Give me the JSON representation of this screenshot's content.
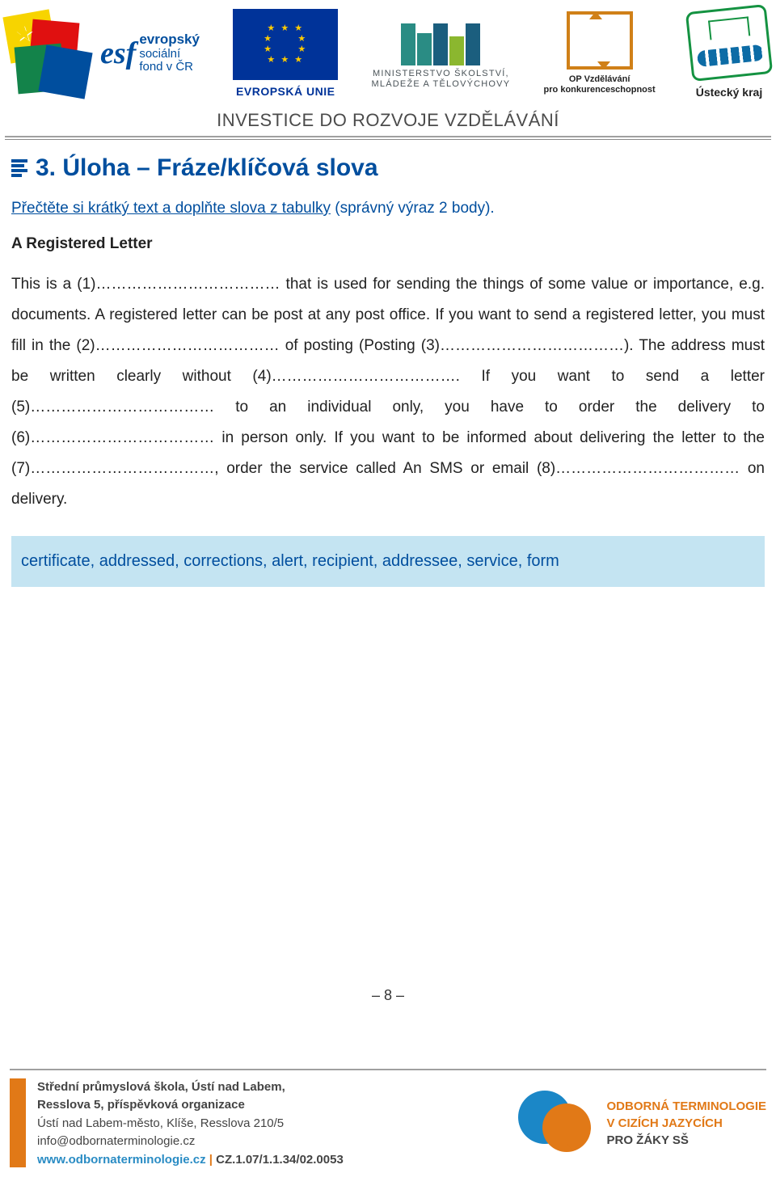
{
  "header": {
    "esf_line1": "evropský",
    "esf_line2": "sociální",
    "esf_line3": "fond v ČR",
    "eu_label": "EVROPSKÁ UNIE",
    "msmt_line1": "MINISTERSTVO ŠKOLSTVÍ,",
    "msmt_line2": "MLÁDEŽE A TĚLOVÝCHOVY",
    "op_line1": "OP Vzdělávání",
    "op_line2": "pro konkurenceschopnost",
    "kraj_label": "Ústecký kraj",
    "tagline": "INVESTICE DO ROZVOJE VZDĚLÁVÁNÍ"
  },
  "section": {
    "title": "3. Úloha – Fráze/klíčová slova",
    "instruction_pre": "Přečtěte si krátký text a doplňte slova z tabulky",
    "instruction_post": " (správný výraz 2 body).",
    "doc_title": "A Registered Letter",
    "body": "This is a (1)……………………………… that is used for sending the things of some value or importance, e.g. documents.  A registered letter can be post at any post office.  If you want to send a registered letter, you must fill in the (2)……………………………… of posting (Posting (3)………………………………). The address must be written clearly without (4)………………………………. If you want to send a letter (5)……………………………… to an individual only, you have to order the delivery to (6)……………………………… in person only. If you want to be informed about delivering the letter to the (7)………………………………, order the service called An SMS or email (8)……………………………… on delivery.",
    "wordbank": "certificate, addressed, corrections, alert, recipient, addressee, service, form"
  },
  "page_number": "– 8 –",
  "footer": {
    "school_l1": "Střední průmyslová škola, Ústí nad Labem,",
    "school_l2": "Resslova 5, příspěvková organizace",
    "school_l3": "Ústí nad Labem-město, Klíše, Resslova 210/5",
    "email": "info@odbornaterminologie.cz",
    "web": "www.odbornaterminologie.cz",
    "code": "CZ.1.07/1.1.34/02.0053",
    "proj_l1": "ODBORNÁ TERMINOLOGIE",
    "proj_l2": "V CIZÍCH JAZYCÍCH",
    "proj_l3": "PRO ŽÁKY SŠ"
  }
}
